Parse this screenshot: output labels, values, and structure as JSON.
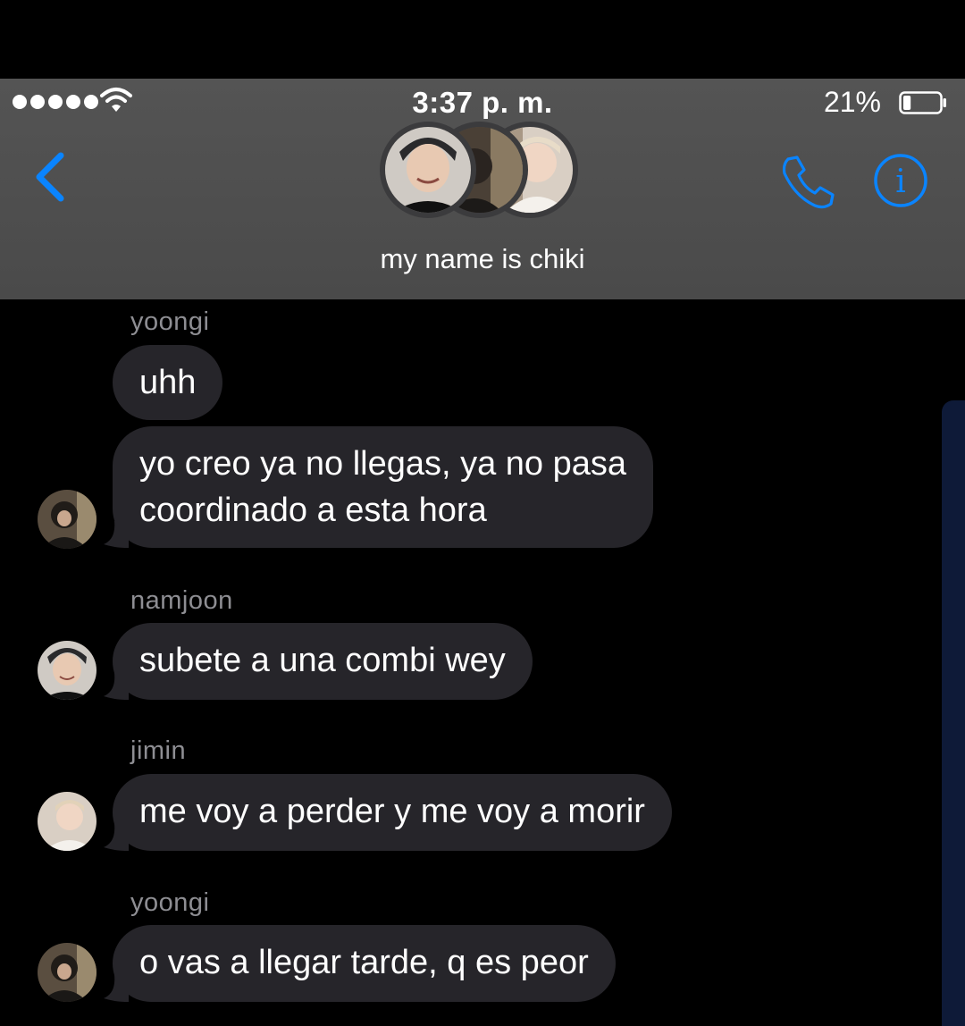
{
  "status_bar": {
    "time": "3:37 p. m.",
    "battery_percent": "21%",
    "battery_level": 0.21,
    "signal_bars": 5
  },
  "header": {
    "group_name": "my name is chiki",
    "icons": {
      "back": "chevron-left-icon",
      "call": "phone-icon",
      "info": "info-icon"
    },
    "accent_color": "#0a84ff"
  },
  "messages": [
    {
      "sender": "yoongi",
      "text": "uhh",
      "show_avatar": false
    },
    {
      "sender": "",
      "text": "yo creo ya no llegas, ya no pasa\ncoordinado a esta hora",
      "show_avatar": true
    },
    {
      "sender": "namjoon",
      "text": "subete a una combi wey",
      "show_avatar": true
    },
    {
      "sender": "jimin",
      "text": "me voy a perder y me voy a morir",
      "show_avatar": true
    },
    {
      "sender": "yoongi",
      "text": "o vas a llegar tarde, q es peor",
      "show_avatar": true
    }
  ]
}
